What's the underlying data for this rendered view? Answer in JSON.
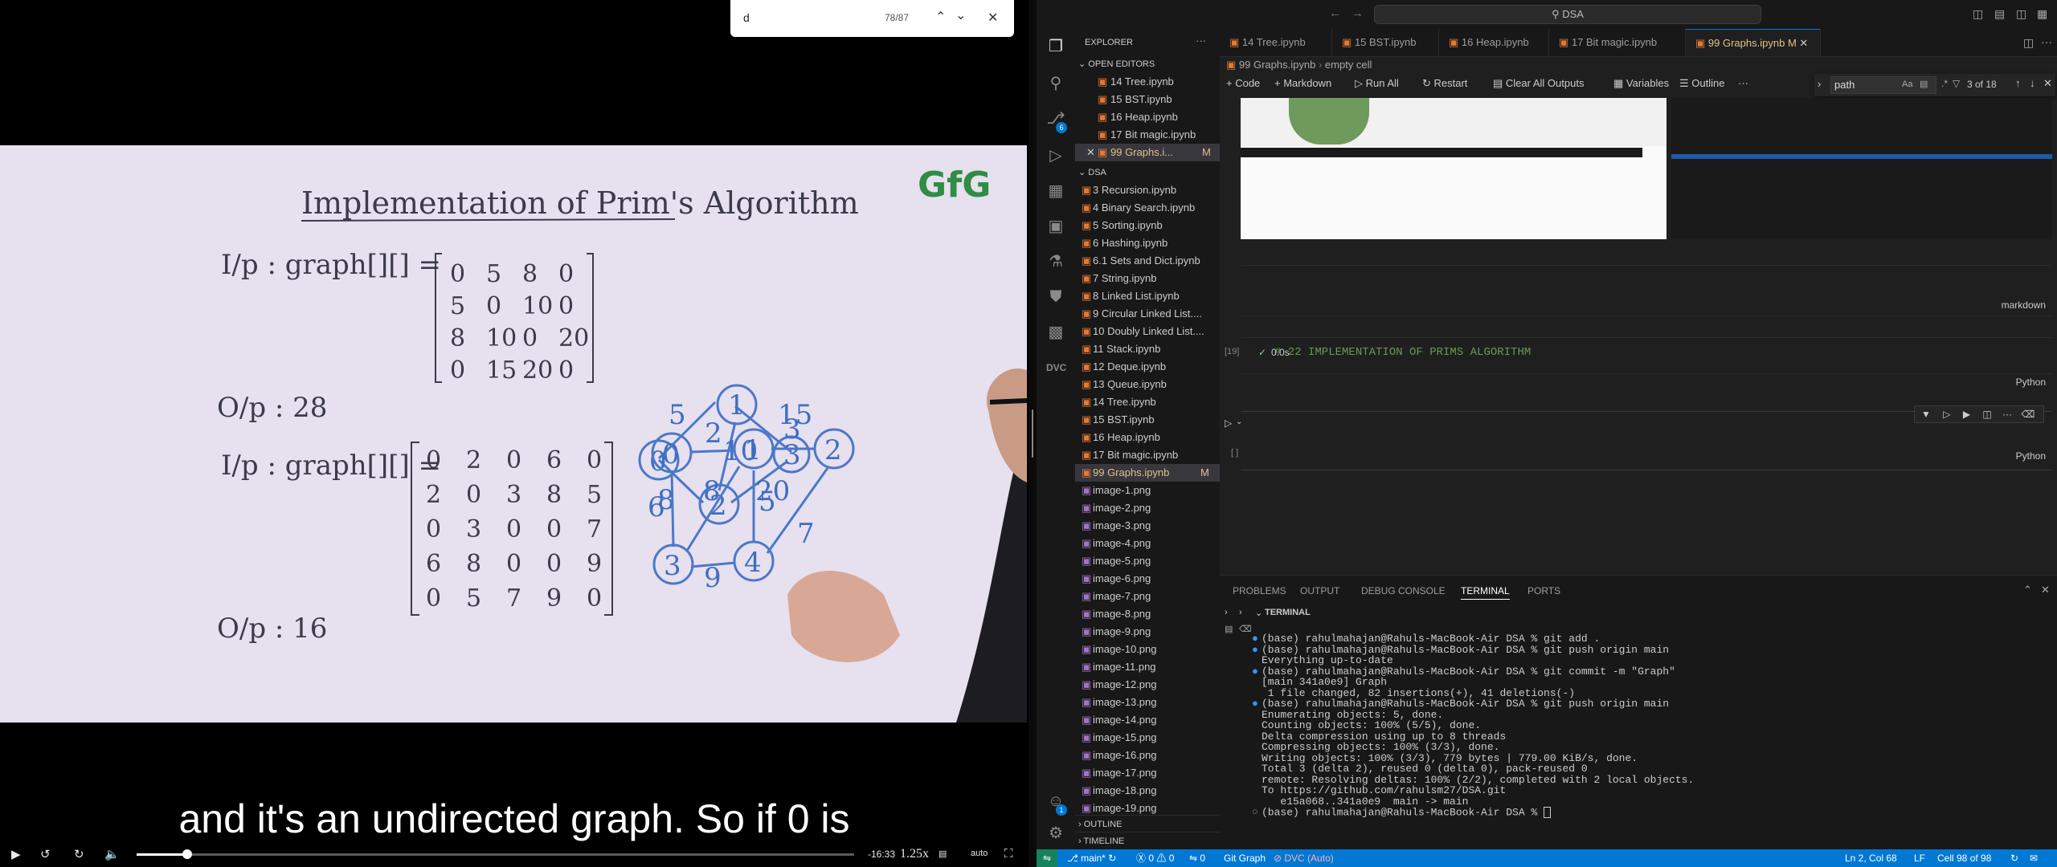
{
  "player": {
    "find": {
      "query": "d",
      "count": "78/87"
    },
    "subtitle": "and it's an undirected graph. So if 0 is",
    "time_remaining": "-16:33",
    "speed": "1.25x",
    "quality": "auto",
    "progress": 0.07,
    "whiteboard": {
      "title": "Implementation of Prim's Algorithm",
      "logo": "GfG",
      "ip_label_1": "I/p : graph[][] =",
      "matrix_1": [
        [
          "0",
          "5",
          "8",
          "0"
        ],
        [
          "5",
          "0",
          "10",
          "0"
        ],
        [
          "8",
          "10",
          "0",
          "20"
        ],
        [
          "0",
          "15",
          "20",
          "0"
        ]
      ],
      "op_1": "O/p :  28",
      "ip_label_2": "I/p : graph[][] =",
      "matrix_2": [
        [
          "0",
          "2",
          "0",
          "6",
          "0"
        ],
        [
          "2",
          "0",
          "3",
          "8",
          "5"
        ],
        [
          "0",
          "3",
          "0",
          "0",
          "7"
        ],
        [
          "6",
          "8",
          "0",
          "0",
          "9"
        ],
        [
          "0",
          "5",
          "7",
          "9",
          "0"
        ]
      ],
      "op_2": "O/p : 16",
      "graph1": {
        "nodes": [
          "0",
          "1",
          "2",
          "3"
        ],
        "weights": [
          "5",
          "15",
          "10",
          "8",
          "20"
        ]
      },
      "graph2": {
        "nodes": [
          "0",
          "1",
          "2",
          "3",
          "4"
        ],
        "weights": [
          "2",
          "3",
          "6",
          "8",
          "5",
          "7",
          "9"
        ]
      }
    }
  },
  "vscode": {
    "command_center": "DSA",
    "explorer_title": "EXPLORER",
    "open_editors_title": "OPEN EDITORS",
    "open_editors": [
      "14 Tree.ipynb",
      "15 BST.ipynb",
      "16 Heap.ipynb",
      "17 Bit magic.ipynb",
      "99 Graphs.i..."
    ],
    "open_editor_modified": "M",
    "folder_title": "DSA",
    "files": [
      "3 Recursion.ipynb",
      "4 Binary Search.ipynb",
      "5 Sorting.ipynb",
      "6 Hashing.ipynb",
      "6.1 Sets and Dict.ipynb",
      "7 String.ipynb",
      "8 Linked List.ipynb",
      "9 Circular Linked List....",
      "10 Doubly Linked List....",
      "11 Stack.ipynb",
      "12 Deque.ipynb",
      "13 Queue.ipynb",
      "14 Tree.ipynb",
      "15 BST.ipynb",
      "16 Heap.ipynb",
      "17 Bit magic.ipynb",
      "99 Graphs.ipynb",
      "image-1.png",
      "image-2.png",
      "image-3.png",
      "image-4.png",
      "image-5.png",
      "image-6.png",
      "image-7.png",
      "image-8.png",
      "image-9.png",
      "image-10.png",
      "image-11.png",
      "image-12.png",
      "image-13.png",
      "image-14.png",
      "image-15.png",
      "image-16.png",
      "image-17.png",
      "image-18.png",
      "image-19.png"
    ],
    "selected_file_modified": "M",
    "outline": "OUTLINE",
    "timeline": "TIMELINE",
    "source_control_badge": "6",
    "accounts_badge": "1",
    "tabs": [
      "14 Tree.ipynb",
      "15 BST.ipynb",
      "16 Heap.ipynb",
      "17 Bit magic.ipynb",
      "99 Graphs.ipynb"
    ],
    "active_tab_modified": "M",
    "breadcrumb": [
      "99 Graphs.ipynb",
      "empty cell"
    ],
    "toolbar": {
      "code": "+ Code",
      "markdown": "+ Markdown",
      "run_all": "Run All",
      "restart": "Restart",
      "clear": "Clear All Outputs",
      "variables": "Variables",
      "outline": "Outline",
      "more": "···"
    },
    "find": {
      "query": "path",
      "aa": "Aa",
      "count": "3 of 18"
    },
    "cells": {
      "markdown_label": "markdown",
      "code_text": "# 22 IMPLEMENTATION OF PRIMS ALGORITHM",
      "exec_count": "[19]",
      "time": "0.0s",
      "lang1": "Python",
      "empty_count": "[ ]",
      "lang2": "Python"
    },
    "panel_tabs": [
      "PROBLEMS",
      "OUTPUT",
      "DEBUG CONSOLE",
      "TERMINAL",
      "PORTS"
    ],
    "terminal_title": "TERMINAL",
    "terminal_lines": [
      {
        "dot": "blue",
        "text": "(base) rahulmahajan@Rahuls-MacBook-Air DSA % git add ."
      },
      {
        "dot": "blue",
        "text": "(base) rahulmahajan@Rahuls-MacBook-Air DSA % git push origin main"
      },
      {
        "dot": "",
        "text": "Everything up-to-date"
      },
      {
        "dot": "blue",
        "text": "(base) rahulmahajan@Rahuls-MacBook-Air DSA % git commit -m \"Graph\""
      },
      {
        "dot": "",
        "text": "[main 341a0e9] Graph"
      },
      {
        "dot": "",
        "text": " 1 file changed, 82 insertions(+), 41 deletions(-)"
      },
      {
        "dot": "blue",
        "text": "(base) rahulmahajan@Rahuls-MacBook-Air DSA % git push origin main"
      },
      {
        "dot": "",
        "text": "Enumerating objects: 5, done."
      },
      {
        "dot": "",
        "text": "Counting objects: 100% (5/5), done."
      },
      {
        "dot": "",
        "text": "Delta compression using up to 8 threads"
      },
      {
        "dot": "",
        "text": "Compressing objects: 100% (3/3), done."
      },
      {
        "dot": "",
        "text": "Writing objects: 100% (3/3), 779 bytes | 779.00 KiB/s, done."
      },
      {
        "dot": "",
        "text": "Total 3 (delta 2), reused 0 (delta 0), pack-reused 0"
      },
      {
        "dot": "",
        "text": "remote: Resolving deltas: 100% (2/2), completed with 2 local objects."
      },
      {
        "dot": "",
        "text": "To https://github.com/rahulsm27/DSA.git"
      },
      {
        "dot": "",
        "text": "   e15a068..341a0e9  main -> main"
      },
      {
        "dot": "grey",
        "text": "(base) rahulmahajan@Rahuls-MacBook-Air DSA % "
      }
    ],
    "status": {
      "branch": "main*",
      "errors": "0",
      "warnings": "0",
      "ports": "0",
      "git_graph": "Git Graph",
      "dvc": "DVC (Auto)",
      "position": "Ln 2, Col 68",
      "eol": "LF",
      "cell": "Cell 98 of 98"
    },
    "colors": {
      "accent": "#0078d4",
      "statusbar": "#0078d4",
      "modified": "#e2c08d"
    }
  }
}
